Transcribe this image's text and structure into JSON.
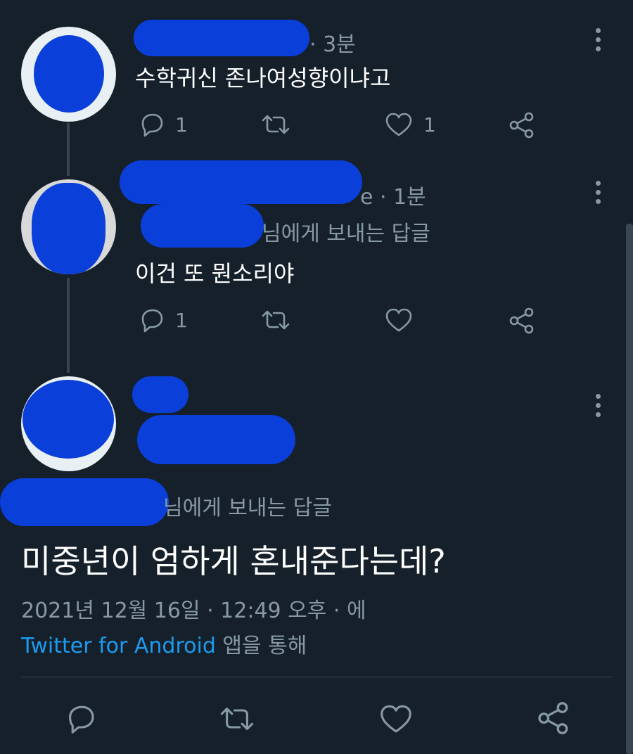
{
  "tweets": [
    {
      "time": "· 3분",
      "text": "수학귀신 존나여성향이냐고",
      "reply_count": "1",
      "like_count": "1"
    },
    {
      "time": "e · 1분",
      "reply_to_suffix": "님에게 보내는 답글",
      "text": "이건 또 뭔소리야",
      "reply_count": "1",
      "like_count": ""
    }
  ],
  "main_tweet": {
    "reply_to_suffix": "님에게 보내는 답글",
    "text": "미중년이 엄하게 혼내준다는데?",
    "timestamp": "2021년 12월 16일 · 12:49 오후 · 에",
    "source_app": "Twitter for Android",
    "source_suffix": " 앱을 통해"
  },
  "icons": {
    "reply": "reply-icon",
    "retweet": "retweet-icon",
    "like": "heart-icon",
    "share": "share-icon",
    "more": "more-vertical-icon"
  },
  "colors": {
    "background": "#15202b",
    "secondary_text": "#8899a6",
    "link": "#1d9bf0",
    "redaction": "#0b3fd9"
  }
}
